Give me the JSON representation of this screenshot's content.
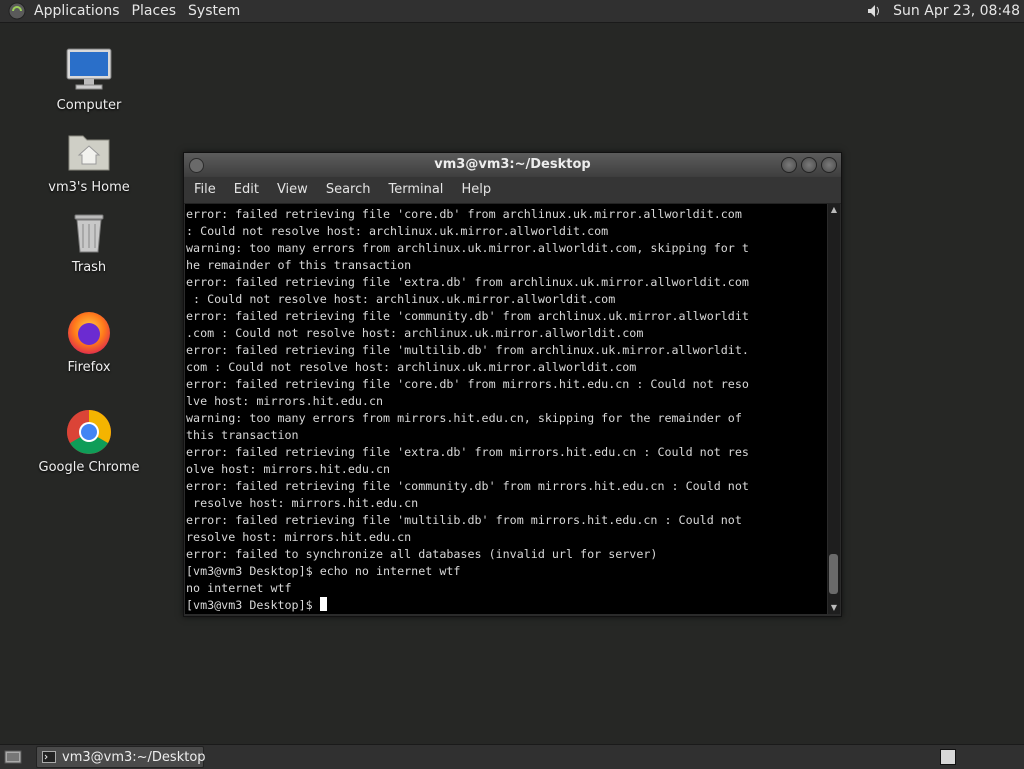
{
  "top_panel": {
    "menus": [
      "Applications",
      "Places",
      "System"
    ],
    "clock": "Sun Apr 23, 08:48"
  },
  "desktop_icons": [
    {
      "label": "Computer",
      "icon": "computer-icon"
    },
    {
      "label": "vm3's Home",
      "icon": "home-folder-icon"
    },
    {
      "label": "Trash",
      "icon": "trash-icon"
    },
    {
      "label": "Firefox",
      "icon": "firefox-icon"
    },
    {
      "label": "Google Chrome",
      "icon": "chrome-icon"
    }
  ],
  "terminal": {
    "title": "vm3@vm3:~/Desktop",
    "menu": [
      "File",
      "Edit",
      "View",
      "Search",
      "Terminal",
      "Help"
    ],
    "lines": [
      "error: failed retrieving file 'core.db' from archlinux.uk.mirror.allworldit.com",
      ": Could not resolve host: archlinux.uk.mirror.allworldit.com",
      "warning: too many errors from archlinux.uk.mirror.allworldit.com, skipping for t",
      "he remainder of this transaction",
      "error: failed retrieving file 'extra.db' from archlinux.uk.mirror.allworldit.com",
      " : Could not resolve host: archlinux.uk.mirror.allworldit.com",
      "error: failed retrieving file 'community.db' from archlinux.uk.mirror.allworldit",
      ".com : Could not resolve host: archlinux.uk.mirror.allworldit.com",
      "error: failed retrieving file 'multilib.db' from archlinux.uk.mirror.allworldit.",
      "com : Could not resolve host: archlinux.uk.mirror.allworldit.com",
      "error: failed retrieving file 'core.db' from mirrors.hit.edu.cn : Could not reso",
      "lve host: mirrors.hit.edu.cn",
      "warning: too many errors from mirrors.hit.edu.cn, skipping for the remainder of",
      "this transaction",
      "error: failed retrieving file 'extra.db' from mirrors.hit.edu.cn : Could not res",
      "olve host: mirrors.hit.edu.cn",
      "error: failed retrieving file 'community.db' from mirrors.hit.edu.cn : Could not",
      " resolve host: mirrors.hit.edu.cn",
      "error: failed retrieving file 'multilib.db' from mirrors.hit.edu.cn : Could not",
      "resolve host: mirrors.hit.edu.cn",
      "error: failed to synchronize all databases (invalid url for server)",
      "[vm3@vm3 Desktop]$ echo no internet wtf",
      "no internet wtf"
    ],
    "prompt": "[vm3@vm3 Desktop]$ "
  },
  "taskbar": {
    "task_label": "vm3@vm3:~/Desktop"
  }
}
